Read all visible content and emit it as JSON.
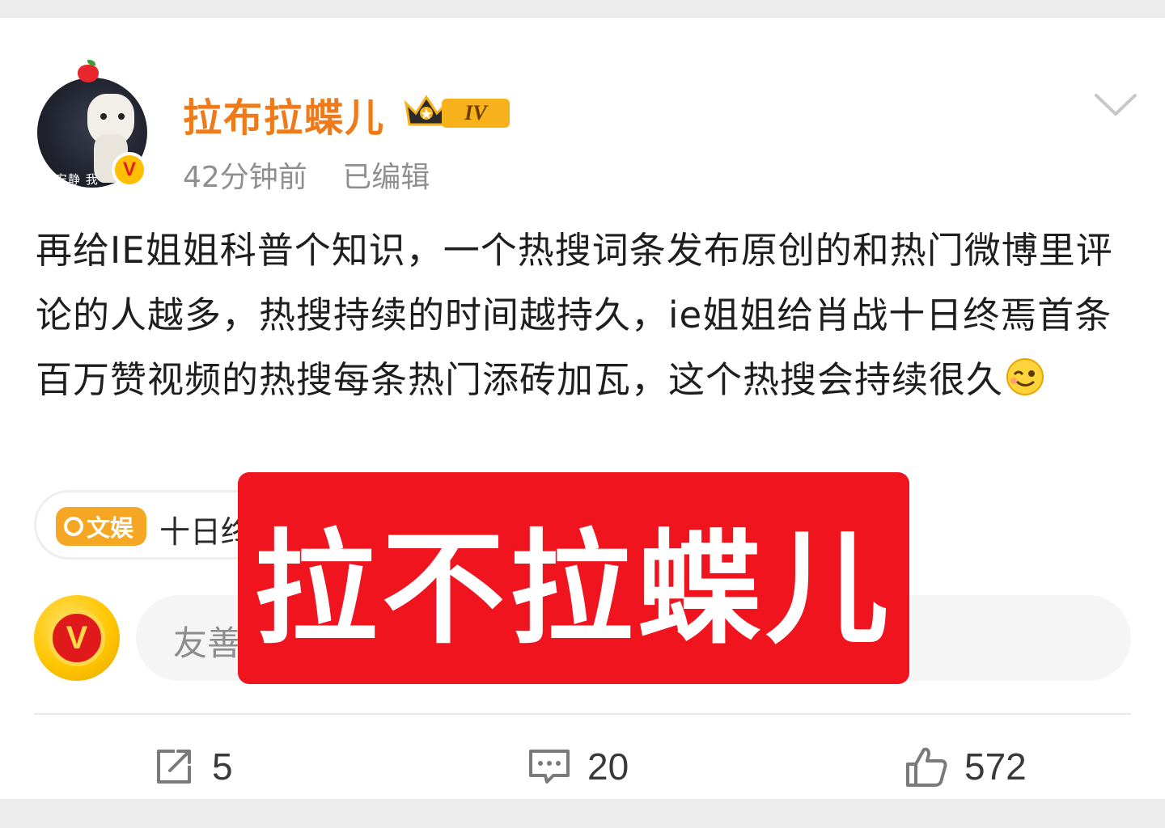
{
  "post": {
    "author": {
      "name": "拉布拉蝶儿",
      "level_badge": "IV",
      "avatar_caption": "安静 我",
      "vip_letter": "V"
    },
    "time": "42分钟前",
    "edited": "已编辑",
    "text": "再给IE姐姐科普个知识，一个热搜词条发布原创的和热门微博里评论的人越多，热搜持续的时间越持久，ie姐姐给肖战十日终焉首条百万赞视频的热搜每条热门添砖加瓦，这个热搜会持续很久",
    "topic": {
      "tag": "文娱",
      "text": "十日终"
    }
  },
  "comment_box": {
    "placeholder": "友善",
    "avatar_letter": "V"
  },
  "overlay": {
    "text": "拉不拉蝶儿"
  },
  "actions": {
    "share_count": "5",
    "comment_count": "20",
    "like_count": "572"
  },
  "colors": {
    "username": "#ee7a1a",
    "overlay_bg": "#f0141e",
    "topic_tag_bg": "#f5a623",
    "vip_gold": "#ffbf00"
  },
  "icons": [
    "apple-icon",
    "vip-badge-icon",
    "crown-icon",
    "chevron-down-icon",
    "wink-emoji-icon",
    "search-icon",
    "share-icon",
    "comment-icon",
    "like-icon"
  ]
}
